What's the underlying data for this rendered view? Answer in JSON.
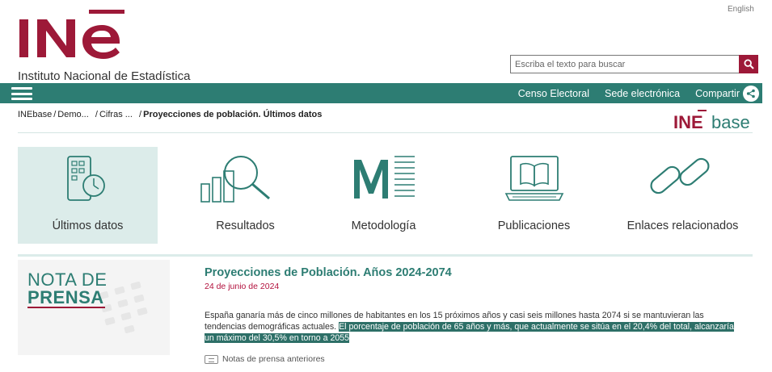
{
  "header": {
    "language_link": "English",
    "logo_text": "INE",
    "logo_subtitle": "Instituto Nacional de Estadística",
    "search_placeholder": "Escriba el texto para buscar"
  },
  "navbar": {
    "links": [
      "Censo Electoral",
      "Sede electrónica",
      "Compartir"
    ]
  },
  "breadcrumb": {
    "items": [
      "INEbase",
      "Demo...",
      "Cifras ...",
      "Proyecciones de población. Últimos datos"
    ]
  },
  "inebase_logo": {
    "ine": "INE",
    "base": "base"
  },
  "tiles": [
    {
      "label": "Últimos datos",
      "icon": "calendar-clock-icon",
      "active": true
    },
    {
      "label": "Resultados",
      "icon": "chart-magnifier-icon",
      "active": false
    },
    {
      "label": "Metodología",
      "icon": "methodology-m-icon",
      "active": false
    },
    {
      "label": "Publicaciones",
      "icon": "laptop-book-icon",
      "active": false
    },
    {
      "label": "Enlaces relacionados",
      "icon": "chain-link-icon",
      "active": false
    }
  ],
  "press": {
    "badge_line1": "NOTA DE",
    "badge_line2": "PRENSA",
    "title": "Proyecciones de Población. Años 2024-2074",
    "date": "24 de junio de 2024",
    "body_plain": "España ganaría más de cinco millones de habitantes en los 15 próximos años y casi seis millones hasta 2074 si se mantuvieran las tendencias demográficas actuales. ",
    "body_highlight": "El porcentaje de población de 65 años y más, que actualmente se sitúa en el 20,4% del total, alcanzaría un máximo del 30,5% en torno a 2055",
    "previous_link": "Notas de prensa anteriores"
  },
  "colors": {
    "brand_red": "#9d1938",
    "brand_teal": "#2d7d73",
    "tile_active_bg": "#dcecea"
  }
}
